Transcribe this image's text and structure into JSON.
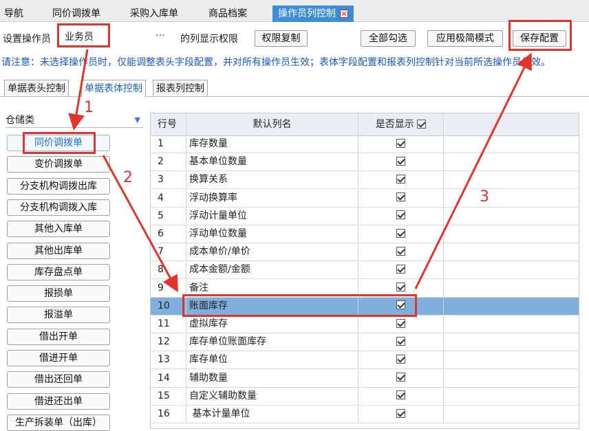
{
  "top_tabs": [
    {
      "label": "导航"
    },
    {
      "label": "同价调拨单"
    },
    {
      "label": "采购入库单"
    },
    {
      "label": "商品档案"
    },
    {
      "label": "操作员列控制",
      "active": true,
      "close_icon": "close-icon"
    }
  ],
  "settings": {
    "operator_label": "设置操作员",
    "operator_value": "业务员",
    "ellipsis": "···",
    "permission_label": "的列显示权限",
    "copy_button": "权限复制",
    "select_all_button": "全部勾选",
    "simple_mode_button": "应用极简模式",
    "save_button": "保存配置"
  },
  "notice": "请注意：未选择操作员时，仅能调整表头字段配置，并对所有操作员生效；表体字段配置和报表列控制针对当前所选操作员生效。",
  "sub_tabs": [
    {
      "label": "单据表头控制"
    },
    {
      "label": "单据表体控制",
      "active": true
    },
    {
      "label": "报表列控制"
    }
  ],
  "category": {
    "value": "仓储类",
    "icon": "chevron-down-icon"
  },
  "doc_types": [
    {
      "label": "同价调拨单",
      "active": true
    },
    {
      "label": "变价调拨单"
    },
    {
      "label": "分支机构调拨出库"
    },
    {
      "label": "分支机构调拨入库"
    },
    {
      "label": "其他入库单"
    },
    {
      "label": "其他出库单"
    },
    {
      "label": "库存盘点单"
    },
    {
      "label": "报损单"
    },
    {
      "label": "报溢单"
    },
    {
      "label": "借出开单"
    },
    {
      "label": "借进开单"
    },
    {
      "label": "借出还回单"
    },
    {
      "label": "借进还出单"
    },
    {
      "label": "生产拆装单（出库）"
    }
  ],
  "table": {
    "headers": {
      "no": "行号",
      "name": "默认列名",
      "show": "是否显示"
    },
    "header_all_checked": true,
    "rows": [
      {
        "no": "1",
        "name": "库存数量",
        "show": true
      },
      {
        "no": "2",
        "name": "基本单位数量",
        "show": true
      },
      {
        "no": "3",
        "name": "换算关系",
        "show": true
      },
      {
        "no": "4",
        "name": "浮动换算率",
        "show": true
      },
      {
        "no": "5",
        "name": "浮动计量单位",
        "show": true
      },
      {
        "no": "6",
        "name": "浮动单位数量",
        "show": true
      },
      {
        "no": "7",
        "name": "成本单价/单价",
        "show": true
      },
      {
        "no": "8",
        "name": "成本金额/金额",
        "show": true
      },
      {
        "no": "9",
        "name": "备注",
        "show": true
      },
      {
        "no": "10",
        "name": "账面库存",
        "show": true,
        "selected": true
      },
      {
        "no": "11",
        "name": "虚拟库存",
        "show": true
      },
      {
        "no": "12",
        "name": "库存单位账面库存",
        "show": true
      },
      {
        "no": "13",
        "name": "库存单位",
        "show": true
      },
      {
        "no": "14",
        "name": "辅助数量",
        "show": true
      },
      {
        "no": "15",
        "name": "自定义辅助数量",
        "show": true
      },
      {
        "no": "16",
        "name": " 基本计量单位",
        "show": true
      }
    ]
  },
  "annotations": {
    "labels": [
      "1",
      "2",
      "3"
    ],
    "color": "#e2342a"
  },
  "colors": {
    "active_tab": "#3e8ed6",
    "notice_text": "#1a56c8",
    "selected_row": "#7fb0dd",
    "header_bg": "#e9eef4"
  }
}
